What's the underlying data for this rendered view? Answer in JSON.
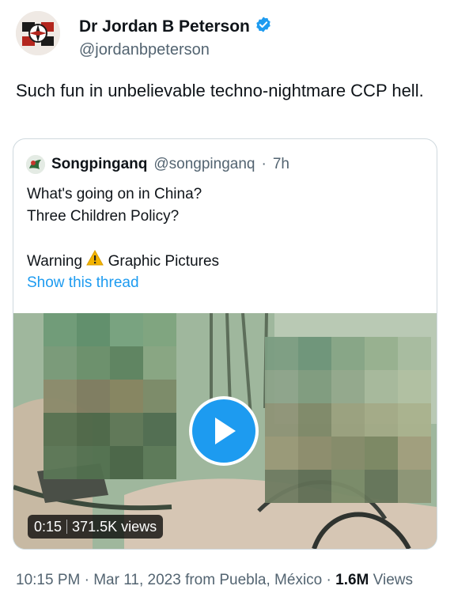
{
  "author": {
    "display_name": "Dr Jordan B Peterson",
    "handle": "@jordanbpeterson",
    "verified_icon": "verified-badge-icon"
  },
  "tweet": {
    "text": "Such fun in unbelievable techno-nightmare CCP hell."
  },
  "quoted_tweet": {
    "display_name": "Songpinganq",
    "handle": "@songpinganq",
    "separator": "·",
    "age": "7h",
    "line1": "What's going on in China?",
    "line2": "Three Children Policy?",
    "warning_label": "Warning",
    "warning_icon": "warning-icon",
    "warning_after": "Graphic Pictures",
    "show_thread": "Show this thread",
    "video": {
      "duration": "0:15",
      "views": "371.5K views"
    }
  },
  "footer": {
    "time": "10:15 PM",
    "dot1": "·",
    "date": "Mar 11, 2023",
    "source": "from Puebla, México",
    "dot2": "·",
    "views_count": "1.6M",
    "views_label": "Views"
  },
  "colors": {
    "accent": "#1d9bf0",
    "muted": "#536471",
    "border": "#cfd9de"
  }
}
